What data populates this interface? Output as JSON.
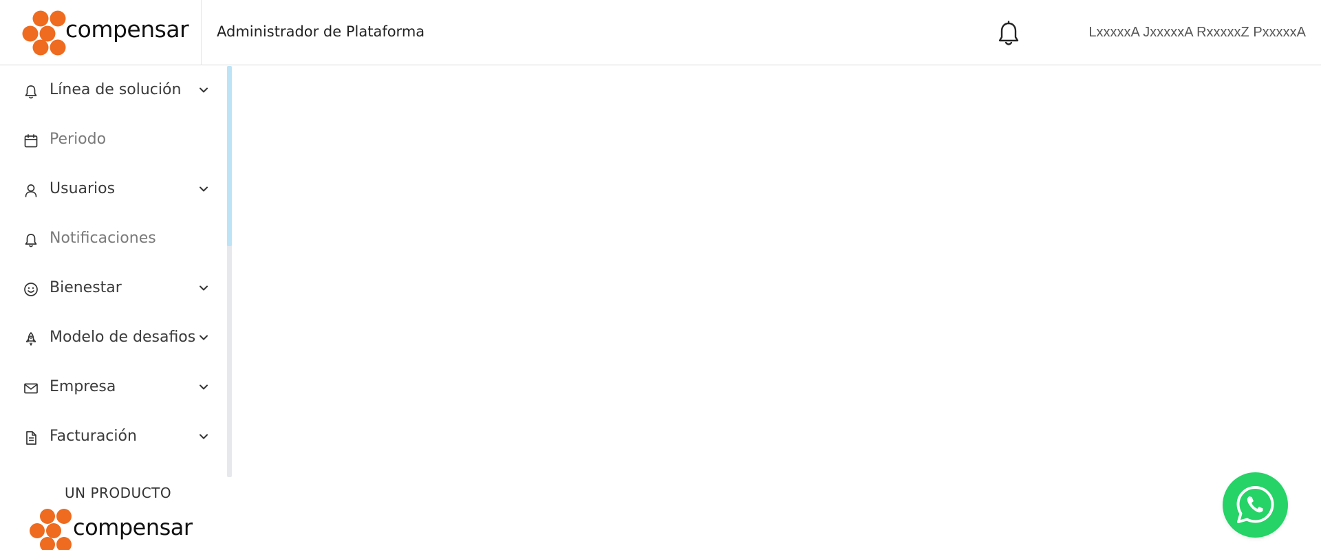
{
  "brand": {
    "name": "compensar",
    "logo_color": "#ee6b1f"
  },
  "header": {
    "title": "Administrador de Plataforma",
    "user_name": "LxxxxxA JxxxxxA RxxxxxZ PxxxxxA",
    "notification_icon": "bell-icon"
  },
  "sidebar": {
    "items": [
      {
        "label": "Línea de solución",
        "icon": "bell-icon",
        "expandable": true,
        "muted": false
      },
      {
        "label": "Periodo",
        "icon": "calendar-icon",
        "expandable": false,
        "muted": true
      },
      {
        "label": "Usuarios",
        "icon": "user-icon",
        "expandable": true,
        "muted": false
      },
      {
        "label": "Notificaciones",
        "icon": "bell-icon",
        "expandable": false,
        "muted": true
      },
      {
        "label": "Bienestar",
        "icon": "smile-icon",
        "expandable": true,
        "muted": false
      },
      {
        "label": "Modelo de desafios",
        "icon": "rocket-icon",
        "expandable": true,
        "muted": false
      },
      {
        "label": "Empresa",
        "icon": "mail-icon",
        "expandable": true,
        "muted": false
      },
      {
        "label": "Facturación",
        "icon": "document-icon",
        "expandable": true,
        "muted": false
      }
    ]
  },
  "footer": {
    "product_label": "UN PRODUCTO",
    "brand_name": "compensar"
  },
  "whatsapp": {
    "icon": "whatsapp-icon",
    "color": "#25d366"
  }
}
